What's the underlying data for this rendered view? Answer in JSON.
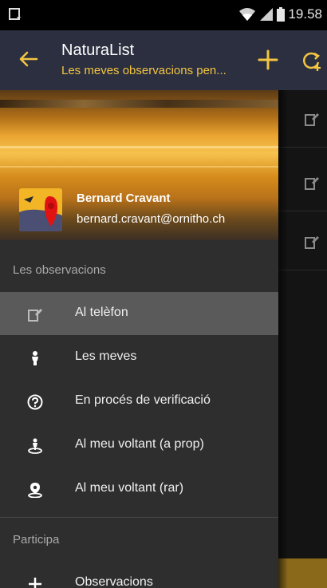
{
  "status_bar": {
    "time": "19.58"
  },
  "action_bar": {
    "title": "NaturaList",
    "subtitle": "Les meves observacions pen..."
  },
  "drawer": {
    "user": {
      "name": "Bernard Cravant",
      "email": "bernard.cravant@ornitho.ch"
    },
    "sections": [
      {
        "header": "Les observacions",
        "items": [
          {
            "label": "Al telèfon",
            "icon": "phone-edit-icon",
            "selected": true
          },
          {
            "label": "Les meves",
            "icon": "person-icon",
            "selected": false
          },
          {
            "label": "En procés de verificació",
            "icon": "question-circle-icon",
            "selected": false
          },
          {
            "label": "Al meu voltant (a prop)",
            "icon": "person-location-icon",
            "selected": false
          },
          {
            "label": "Al meu voltant (rar)",
            "icon": "location-pin-icon",
            "selected": false
          }
        ]
      },
      {
        "header": "Participa",
        "items": [
          {
            "label": "Observacions",
            "icon": "plus-icon",
            "selected": false
          }
        ]
      }
    ]
  },
  "colors": {
    "accent": "#f4c542",
    "action_bar": "#2b2f3f",
    "drawer": "#2e2e2e",
    "selected": "#5a5a5a"
  }
}
